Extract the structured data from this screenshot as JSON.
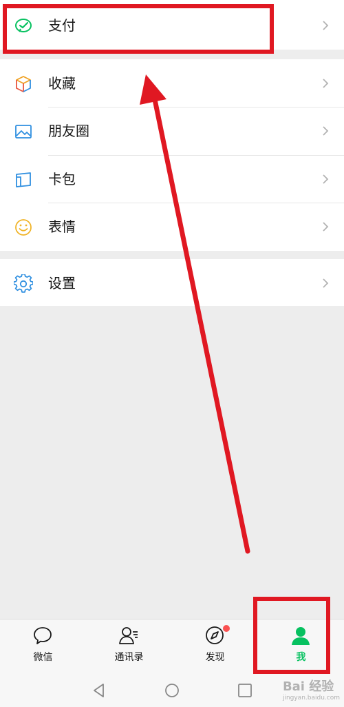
{
  "menu": {
    "pay": {
      "label": "支付",
      "icon": "wechat-pay-icon"
    },
    "favorites": {
      "label": "收藏",
      "icon": "cube-icon"
    },
    "moments": {
      "label": "朋友圈",
      "icon": "image-icon"
    },
    "cards": {
      "label": "卡包",
      "icon": "card-wallet-icon"
    },
    "stickers": {
      "label": "表情",
      "icon": "smiley-icon"
    },
    "settings": {
      "label": "设置",
      "icon": "gear-icon"
    }
  },
  "tabs": [
    {
      "label": "微信",
      "icon": "chat-bubble-icon",
      "active": false
    },
    {
      "label": "通讯录",
      "icon": "contacts-icon",
      "active": false
    },
    {
      "label": "发现",
      "icon": "compass-icon",
      "active": false,
      "badge": true
    },
    {
      "label": "我",
      "icon": "person-icon",
      "active": true
    }
  ],
  "colors": {
    "accent": "#07c160",
    "annotation": "#e01822",
    "background": "#ededed",
    "badge": "#fa5151"
  },
  "watermark": {
    "text": "Bai 经验",
    "sub": "jingyan.baidu.com"
  }
}
